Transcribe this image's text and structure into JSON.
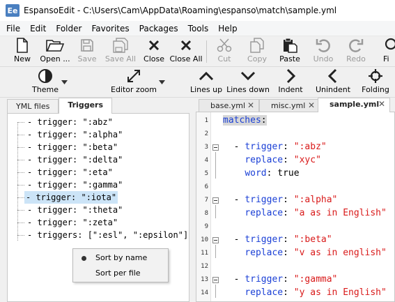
{
  "window": {
    "app_icon_text": "Ee",
    "title": "EspansoEdit - C:\\Users\\Cam\\AppData\\Roaming\\espanso\\match\\sample.yml"
  },
  "menu": [
    "File",
    "Edit",
    "Folder",
    "Favorites",
    "Packages",
    "Tools",
    "Help"
  ],
  "toolbar_main": [
    {
      "label": "New",
      "icon": "new-file-icon",
      "enabled": true
    },
    {
      "label": "Open ...",
      "icon": "folder-open-icon",
      "enabled": true
    },
    {
      "label": "Save",
      "icon": "save-icon",
      "enabled": false
    },
    {
      "label": "Save All",
      "icon": "save-all-icon",
      "enabled": false
    },
    {
      "label": "Close",
      "icon": "close-icon",
      "enabled": true
    },
    {
      "label": "Close All",
      "icon": "close-all-icon",
      "enabled": true
    },
    {
      "label": "Cut",
      "icon": "scissors-icon",
      "enabled": false
    },
    {
      "label": "Copy",
      "icon": "copy-icon",
      "enabled": false
    },
    {
      "label": "Paste",
      "icon": "paste-icon",
      "enabled": true
    },
    {
      "label": "Undo",
      "icon": "undo-icon",
      "enabled": false
    },
    {
      "label": "Redo",
      "icon": "redo-icon",
      "enabled": false
    },
    {
      "label": "Fi",
      "icon": "find-icon",
      "enabled": true
    }
  ],
  "toolbar_view": [
    {
      "label": "Theme",
      "icon": "theme-icon"
    },
    {
      "label": "Editor zoom",
      "icon": "zoom-icon"
    },
    {
      "label": "Lines up",
      "icon": "chevron-up-icon"
    },
    {
      "label": "Lines down",
      "icon": "chevron-down-icon"
    },
    {
      "label": "Indent",
      "icon": "chevron-right-icon"
    },
    {
      "label": "Unindent",
      "icon": "chevron-left-icon"
    },
    {
      "label": "Folding",
      "icon": "folding-icon"
    }
  ],
  "left_tabs": [
    "YML files",
    "Triggers"
  ],
  "left_active_tab": "Triggers",
  "triggers": [
    "- trigger: \":abz\"",
    "- trigger: \":alpha\"",
    "- trigger: \":beta\"",
    "- trigger: \":delta\"",
    "- trigger: \":eta\"",
    "- trigger: \":gamma\"",
    "- trigger: \":iota\"",
    "- trigger: \":theta\"",
    "- trigger: \":zeta\"",
    "- triggers: [\":esl\", \":epsilon\"]"
  ],
  "selected_trigger": "- trigger: \":iota\"",
  "context_menu": {
    "items": [
      "Sort by name",
      "Sort per file"
    ],
    "checked": "Sort by name"
  },
  "doc_tabs": [
    {
      "label": "base.yml",
      "active": false
    },
    {
      "label": "misc.yml",
      "active": false
    },
    {
      "label": "sample.yml",
      "active": true
    }
  ],
  "code_lines": [
    {
      "n": "1",
      "text": "matches:"
    },
    {
      "n": "2",
      "text": ""
    },
    {
      "n": "3",
      "text": "  - trigger: \":abz\""
    },
    {
      "n": "4",
      "text": "    replace: \"xyc\""
    },
    {
      "n": "5",
      "text": "    word: true"
    },
    {
      "n": "6",
      "text": ""
    },
    {
      "n": "7",
      "text": "  - trigger: \":alpha\""
    },
    {
      "n": "8",
      "text": "    replace: \"a as in English\""
    },
    {
      "n": "9",
      "text": ""
    },
    {
      "n": "10",
      "text": "  - trigger: \":beta\""
    },
    {
      "n": "11",
      "text": "    replace: \"v as in english\""
    },
    {
      "n": "12",
      "text": ""
    },
    {
      "n": "13",
      "text": "  - trigger: \":gamma\""
    },
    {
      "n": "14",
      "text": "    replace: \"y as in English\""
    }
  ],
  "colors": {
    "keyword": "#1a3fd6",
    "string": "#d91a1a",
    "selection": "#cce4f7"
  }
}
